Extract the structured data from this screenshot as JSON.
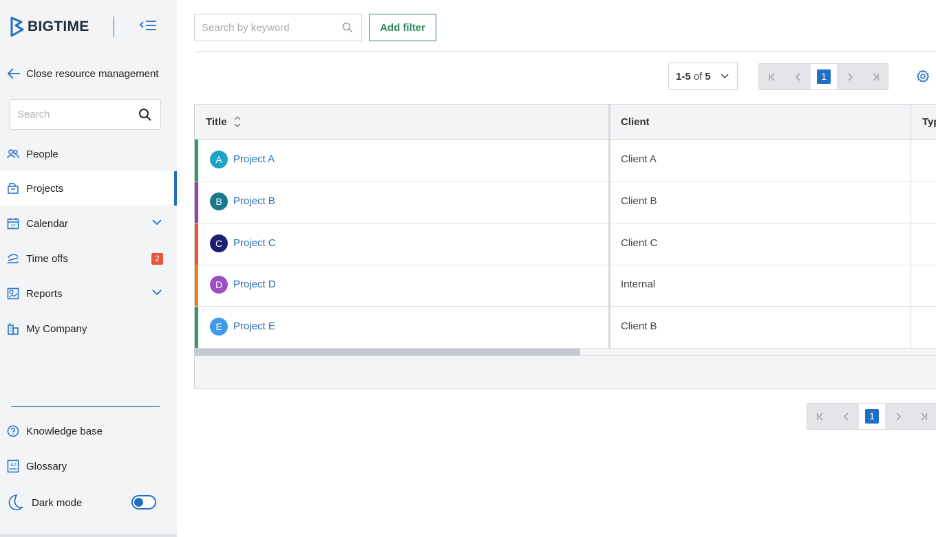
{
  "brand": {
    "name": "BIGTIME",
    "accent": "#1f6fc5"
  },
  "sidebar": {
    "close_label": "Close resource management",
    "search_placeholder": "Search",
    "items": [
      {
        "label": "People",
        "icon": "people-icon"
      },
      {
        "label": "Projects",
        "icon": "projects-icon",
        "active": true
      },
      {
        "label": "Calendar",
        "icon": "calendar-icon",
        "expandable": true
      },
      {
        "label": "Time offs",
        "icon": "time-off-icon",
        "badge": "2"
      },
      {
        "label": "Reports",
        "icon": "reports-icon",
        "expandable": true
      },
      {
        "label": "My Company",
        "icon": "company-icon"
      }
    ],
    "bottom": {
      "knowledge_base": "Knowledge base",
      "glossary": "Glossary",
      "dark_mode": "Dark mode",
      "dark_mode_on": false
    }
  },
  "toolbar": {
    "search_placeholder": "Search by keyword",
    "add_filter": "Add filter"
  },
  "pagination": {
    "range": "1-5",
    "of": "of",
    "total": "5",
    "current_page": "1"
  },
  "table": {
    "columns": [
      "Title",
      "Client",
      "Typ"
    ],
    "rows": [
      {
        "initial": "A",
        "title": "Project A",
        "client": "Client A",
        "stripe": "#2e9e5b",
        "avatar": "#1ea3c4"
      },
      {
        "initial": "B",
        "title": "Project B",
        "client": "Client B",
        "stripe": "#8e44ad",
        "avatar": "#177a8c"
      },
      {
        "initial": "C",
        "title": "Project C",
        "client": "Client C",
        "stripe": "#e8553a",
        "avatar": "#1b1f6e"
      },
      {
        "initial": "D",
        "title": "Project D",
        "client": "Internal",
        "stripe": "#e67e22",
        "avatar": "#9b4fc4"
      },
      {
        "initial": "E",
        "title": "Project E",
        "client": "Client B",
        "stripe": "#2e9e5b",
        "avatar": "#3d9be9"
      }
    ]
  }
}
